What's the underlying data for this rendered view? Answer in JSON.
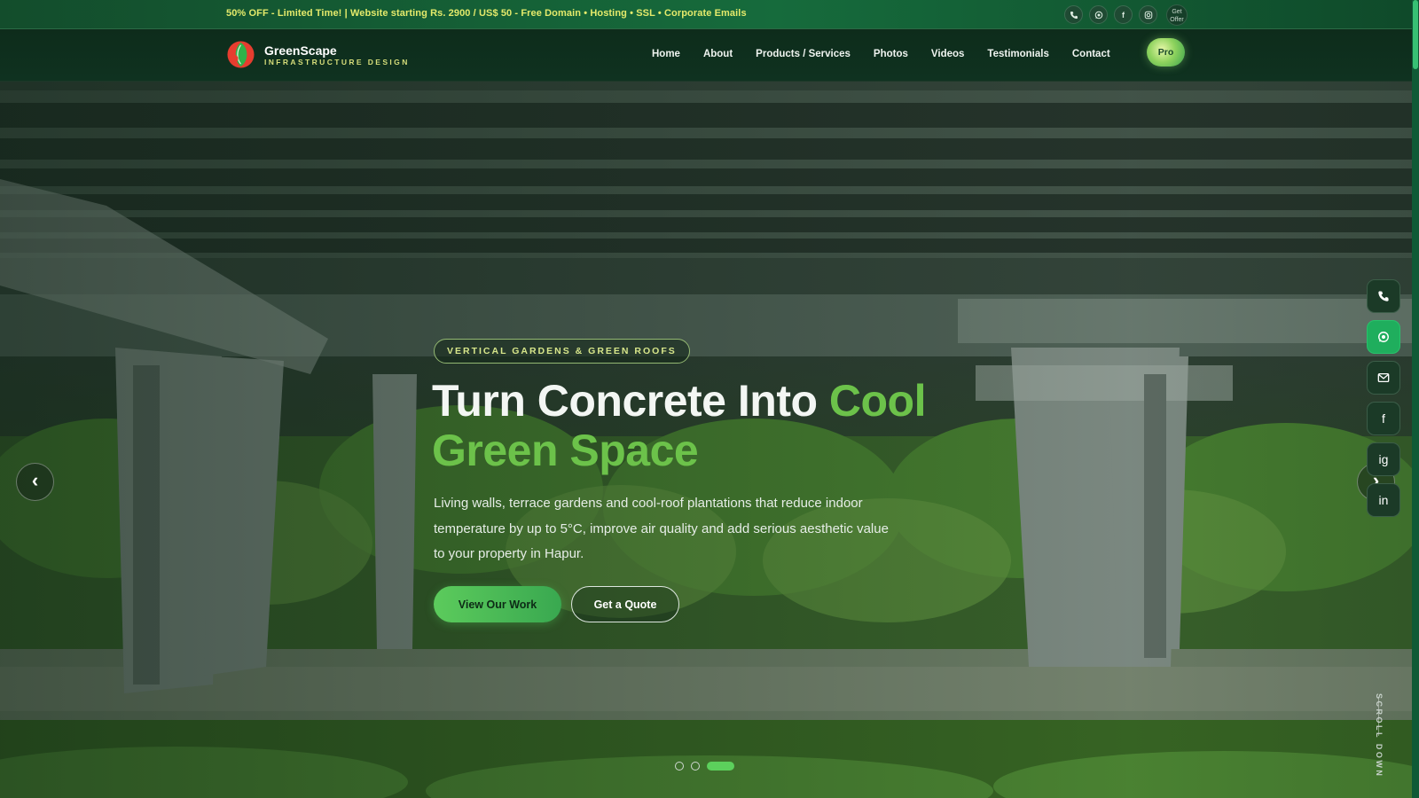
{
  "topbar": {
    "promo": "50% OFF - Limited Time! | Website starting Rs. 2900 / US$ 50 - Free Domain • Hosting • SSL • Corporate Emails",
    "icons": [
      "phone-icon",
      "whatsapp-icon",
      "facebook-icon",
      "instagram-icon"
    ],
    "facebook_glyph": "f",
    "get_offer": "Get Offer"
  },
  "header": {
    "brand_name": "GreenScape",
    "brand_tagline": "INFRASTRUCTURE DESIGN",
    "nav": [
      "Home",
      "About",
      "Products / Services",
      "Photos",
      "Videos",
      "Testimonials",
      "Contact"
    ],
    "pro_label": "Pro"
  },
  "hero": {
    "eyebrow": "VERTICAL GARDENS & GREEN ROOFS",
    "headline_main": "Turn Concrete Into ",
    "headline_accent": "Cool Green Space",
    "subtext": "Living walls, terrace gardens and cool-roof plantations that reduce indoor temperature by up to 5°C, improve air quality and add serious aesthetic value to your property in Hapur.",
    "primary_cta": "View Our Work",
    "secondary_cta": "Get a Quote",
    "prev_glyph": "‹",
    "next_glyph": "›",
    "slides": 3,
    "active_slide": 3
  },
  "side_dock": {
    "items": [
      "phone-icon",
      "whatsapp-icon",
      "mail-icon",
      "facebook-icon",
      "instagram-icon",
      "linkedin-icon"
    ],
    "facebook_glyph": "f",
    "instagram_glyph": "ig",
    "linkedin_glyph": "in"
  },
  "scroll_hint": "SCROLL DOWN",
  "colors": {
    "accent_green": "#6cc24a",
    "promo_yellow": "#e4ea6b",
    "whatsapp_green": "#1fae5d",
    "header_bg": "#0e2c1b"
  }
}
